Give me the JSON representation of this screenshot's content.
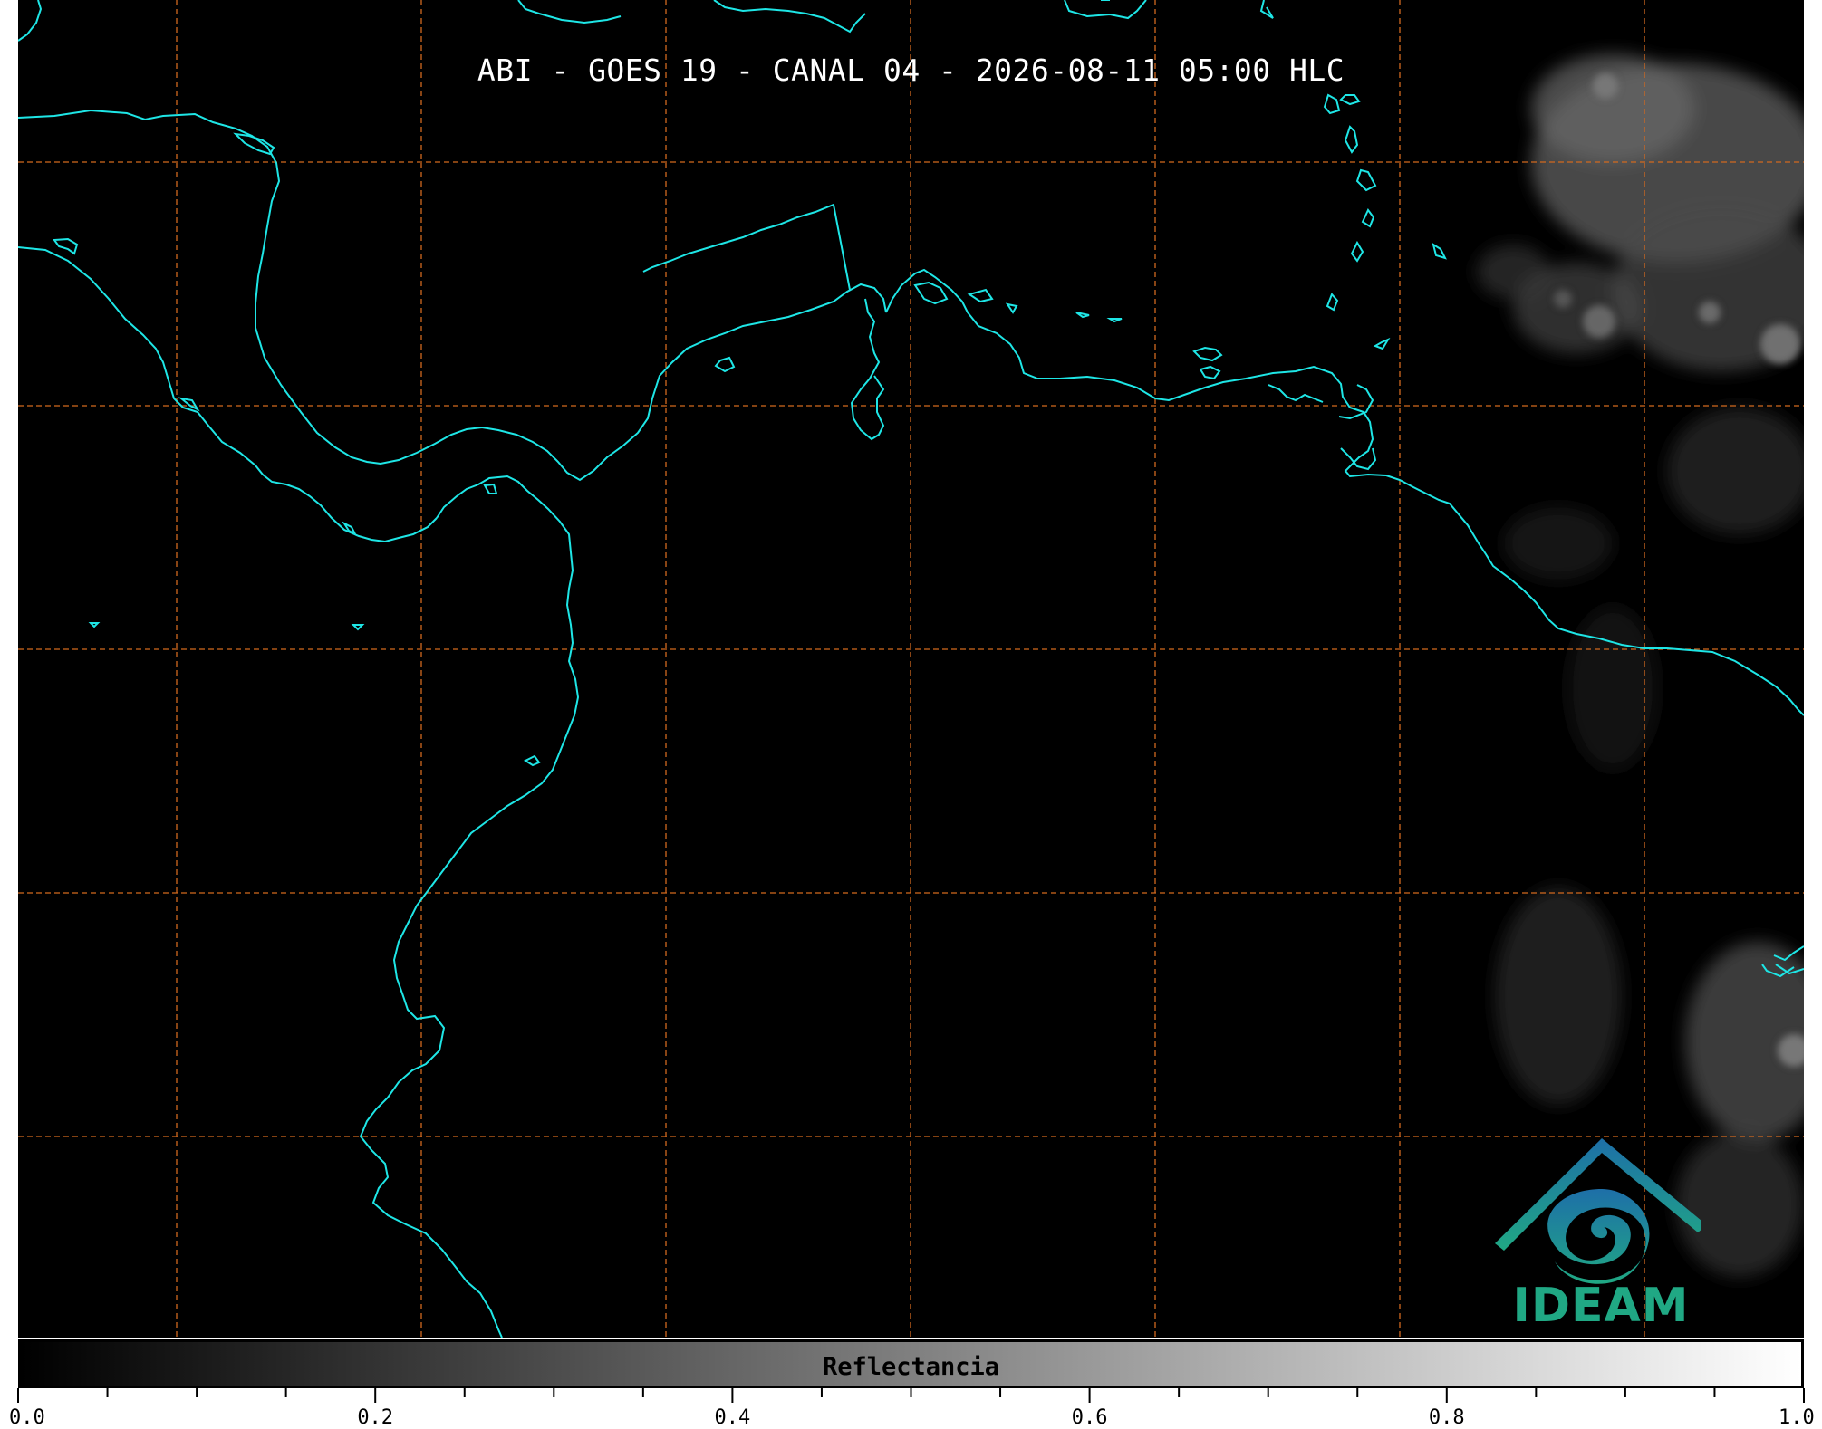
{
  "map": {
    "title": "ABI - GOES 19 - CANAL 04 - 2026-08-11 05:00 HLC",
    "background_color": "#000000",
    "coastline_color": "#1ee6e6",
    "gridline_color": "#d2691e",
    "gridline_style": "dashed"
  },
  "logo": {
    "text": "IDEAM",
    "colors": [
      "#1e6fa8",
      "#20a884"
    ]
  },
  "colorbar": {
    "label": "Reflectancia",
    "range": [
      0.0,
      1.0
    ],
    "gradient": [
      "#000000",
      "#ffffff"
    ],
    "major_ticks": [
      "0.0",
      "0.2",
      "0.4",
      "0.6",
      "0.8",
      "1.0"
    ],
    "minor_tick_step": 0.05
  }
}
